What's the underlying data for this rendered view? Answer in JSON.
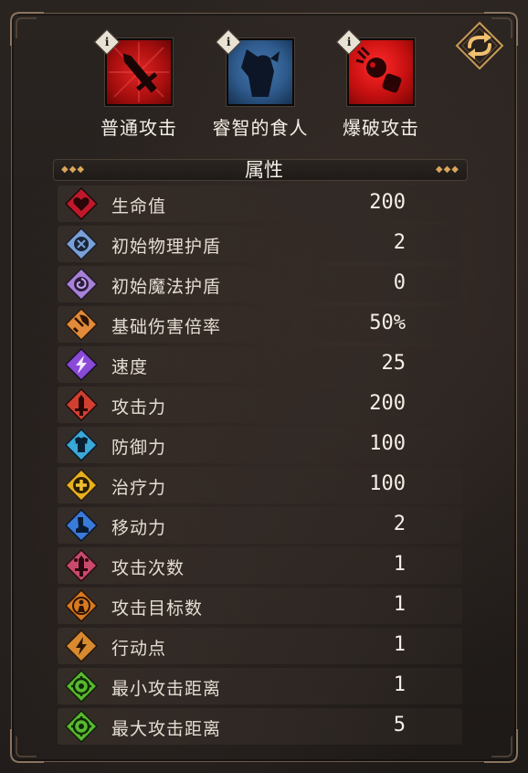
{
  "colors": {
    "accent_gold": "#d9a55c",
    "text_primary": "#f4efe6",
    "skill_red": "#c81818",
    "skill_blue": "#2e5a8c"
  },
  "header": {
    "swap_icon": "swap-arrows-icon"
  },
  "skills": [
    {
      "label": "普通攻击",
      "icon": "dagger-icon",
      "info": "i"
    },
    {
      "label": "睿智的食人",
      "icon": "cloaked-figure-icon",
      "info": "i"
    },
    {
      "label": "爆破攻击",
      "icon": "bomb-icon",
      "info": "i"
    }
  ],
  "attributes": {
    "title": "属性",
    "rows": [
      {
        "label": "生命值",
        "value": "200",
        "icon": "heart-icon"
      },
      {
        "label": "初始物理护盾",
        "value": "2",
        "icon": "physical-shield-icon"
      },
      {
        "label": "初始魔法护盾",
        "value": "0",
        "icon": "magic-shield-icon"
      },
      {
        "label": "基础伤害倍率",
        "value": "50%",
        "icon": "axe-icon"
      },
      {
        "label": "速度",
        "value": "25",
        "icon": "lightning-icon"
      },
      {
        "label": "攻击力",
        "value": "200",
        "icon": "sword-icon"
      },
      {
        "label": "防御力",
        "value": "100",
        "icon": "armor-icon"
      },
      {
        "label": "治疗力",
        "value": "100",
        "icon": "heal-cross-icon"
      },
      {
        "label": "移动力",
        "value": "2",
        "icon": "boot-icon"
      },
      {
        "label": "攻击次数",
        "value": "1",
        "icon": "multi-strike-icon"
      },
      {
        "label": "攻击目标数",
        "value": "1",
        "icon": "target-person-icon"
      },
      {
        "label": "行动点",
        "value": "1",
        "icon": "action-bolt-icon"
      },
      {
        "label": "最小攻击距离",
        "value": "1",
        "icon": "crosshair-min-icon"
      },
      {
        "label": "最大攻击距离",
        "value": "5",
        "icon": "crosshair-max-icon"
      }
    ]
  }
}
